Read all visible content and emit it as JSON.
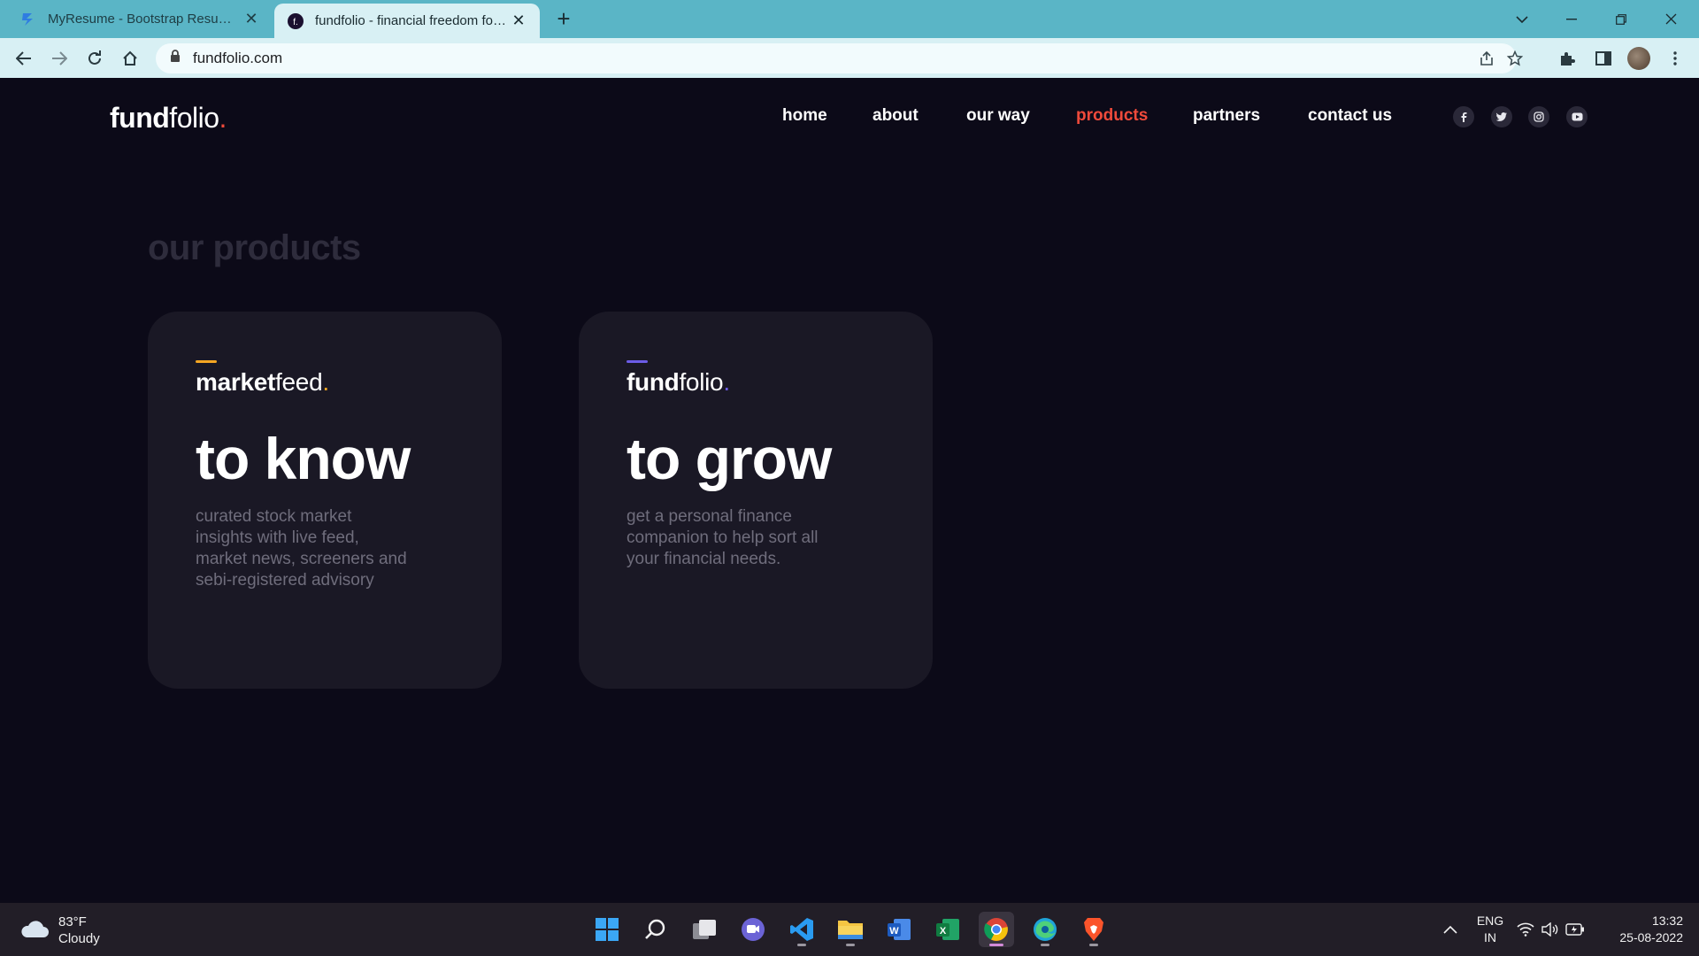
{
  "browser": {
    "tabs": [
      {
        "title": "MyResume - Bootstrap Resume and CV Template",
        "active": false
      },
      {
        "title": "fundfolio - financial freedom for all",
        "active": true
      }
    ],
    "new_tab_label": "+",
    "url": "fundfolio.com"
  },
  "site": {
    "logo_bold": "fund",
    "logo_light": "folio",
    "logo_dot": ".",
    "nav": [
      {
        "label": "home",
        "active": false
      },
      {
        "label": "about",
        "active": false
      },
      {
        "label": "our way",
        "active": false
      },
      {
        "label": "products",
        "active": true
      },
      {
        "label": "partners",
        "active": false
      },
      {
        "label": "contact us",
        "active": false
      }
    ],
    "social_icons": [
      "facebook-icon",
      "twitter-icon",
      "instagram-icon",
      "youtube-icon"
    ]
  },
  "products": {
    "title": "our products",
    "cards": [
      {
        "brand_bold": "market",
        "brand_light": "feed",
        "brand_dot": ".",
        "accent_color": "#f5a623",
        "dot_color": "#f5a623",
        "headline": "to know",
        "description": "curated stock market insights with live feed, market news, screeners and sebi-registered advisory"
      },
      {
        "brand_bold": "fund",
        "brand_light": "folio",
        "brand_dot": ".",
        "accent_color": "#6c5ce7",
        "dot_color": "#6c5ce7",
        "headline": "to grow",
        "description": "get a personal finance companion to help sort all your financial needs."
      }
    ]
  },
  "taskbar": {
    "weather_temp": "83°F",
    "weather_desc": "Cloudy",
    "apps": [
      "start-icon",
      "search-icon",
      "task-view-icon",
      "teams-chat-icon",
      "vscode-icon",
      "file-explorer-icon",
      "word-icon",
      "excel-icon",
      "chrome-icon",
      "edge-icon",
      "brave-icon"
    ],
    "lang_top": "ENG",
    "lang_bottom": "IN",
    "time": "13:32",
    "date": "25-08-2022"
  },
  "colors": {
    "accent_red": "#ef4a3b",
    "page_bg": "#0c0a18",
    "card_bg": "#1a1825",
    "tabbar": "#5ab5c6"
  }
}
